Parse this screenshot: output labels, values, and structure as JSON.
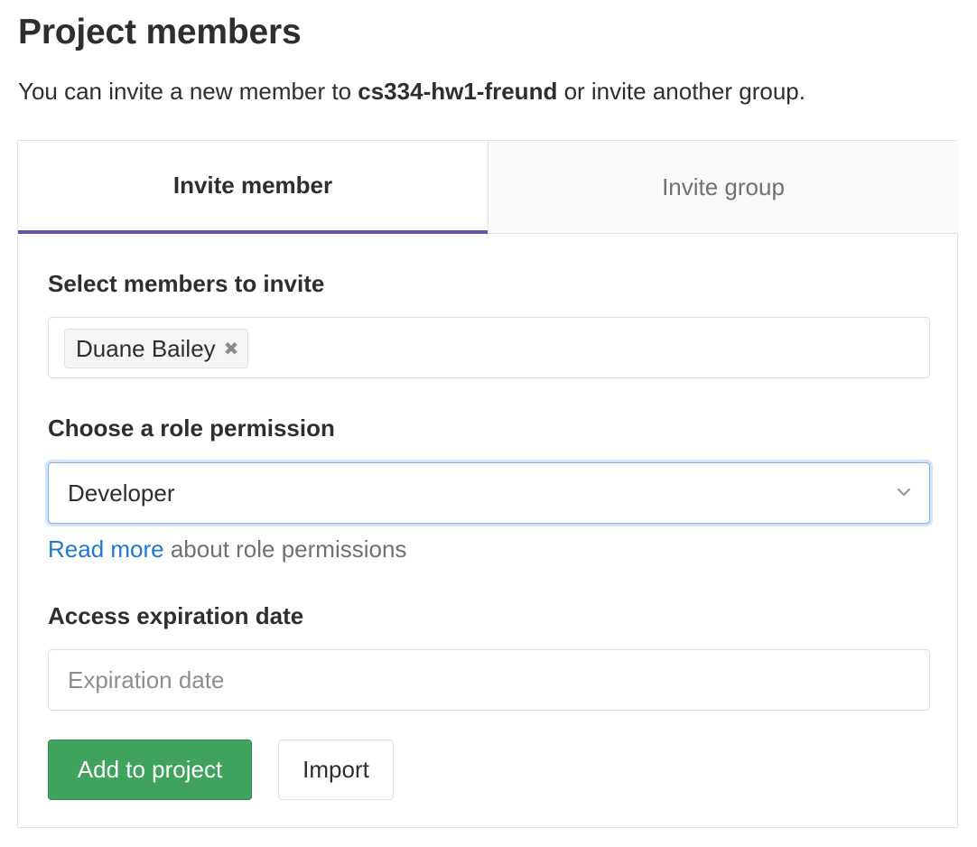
{
  "header": {
    "title": "Project members",
    "subtitle_prefix": "You can invite a new member to ",
    "project_name": "cs334-hw1-freund",
    "subtitle_suffix": " or invite another group."
  },
  "tabs": [
    {
      "label": "Invite member",
      "active": true
    },
    {
      "label": "Invite group",
      "active": false
    }
  ],
  "form": {
    "members_label": "Select members to invite",
    "selected_members": [
      {
        "name": "Duane Bailey",
        "remove_icon": "close-icon"
      }
    ],
    "role_label": "Choose a role permission",
    "role_value": "Developer",
    "role_chevron_icon": "chevron-down-icon",
    "help_link": "Read more",
    "help_text": " about role permissions",
    "expiration_label": "Access expiration date",
    "expiration_value": "",
    "expiration_placeholder": "Expiration date",
    "submit_label": "Add to project",
    "import_label": "Import"
  },
  "colors": {
    "accent_tab": "#6b4fbb",
    "success": "#3fa35e",
    "link": "#1f78d1",
    "focus": "#80b3f0"
  }
}
